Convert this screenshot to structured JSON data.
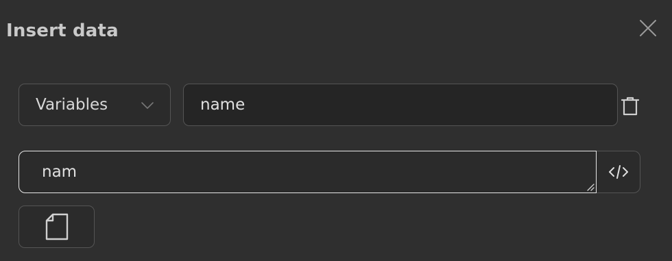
{
  "dialog": {
    "title": "Insert data",
    "close_icon": "close-icon"
  },
  "row1": {
    "source_select": {
      "selected": "Variables",
      "icon": "chevron-down-icon"
    },
    "name_input": {
      "value": "name"
    },
    "delete_icon": "trash-icon"
  },
  "row2": {
    "value_field": {
      "value": "nam"
    },
    "code_icon": "code-icon"
  },
  "row3": {
    "document_icon": "document-icon"
  },
  "colors": {
    "background": "#2f2f2f",
    "field_background": "#2b2b2b",
    "border": "#555555",
    "focus_border": "#e8e8e8",
    "text": "#e0e0e0"
  }
}
